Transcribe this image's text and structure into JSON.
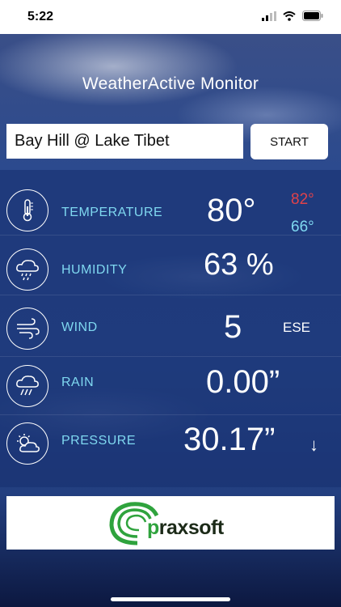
{
  "status_bar": {
    "time": "5:22"
  },
  "app": {
    "title": "WeatherActive Monitor"
  },
  "location": {
    "value": "Bay Hill @ Lake Tibet"
  },
  "start_button": {
    "label": "START"
  },
  "readings": {
    "temperature": {
      "label": "TEMPERATURE",
      "value": "80°",
      "high": "82°",
      "low": "66°"
    },
    "humidity": {
      "label": "HUMIDITY",
      "value": "63 %"
    },
    "wind": {
      "label": "WIND",
      "value": "5",
      "direction": "ESE"
    },
    "rain": {
      "label": "RAIN",
      "value": "0.00”"
    },
    "pressure": {
      "label": "PRESSURE",
      "value": "30.17”",
      "trend": "↓"
    }
  },
  "sponsor": {
    "brand_prefix": "p",
    "brand_rest": "raxsoft"
  },
  "colors": {
    "label_cyan": "#7fd8f0",
    "high_red": "#e0424a",
    "brand_green": "#2fa33d"
  },
  "icons": {
    "temperature": "thermometer-icon",
    "humidity": "cloud-drizzle-icon",
    "wind": "wind-icon",
    "rain": "cloud-rain-icon",
    "pressure": "partly-cloudy-icon"
  }
}
